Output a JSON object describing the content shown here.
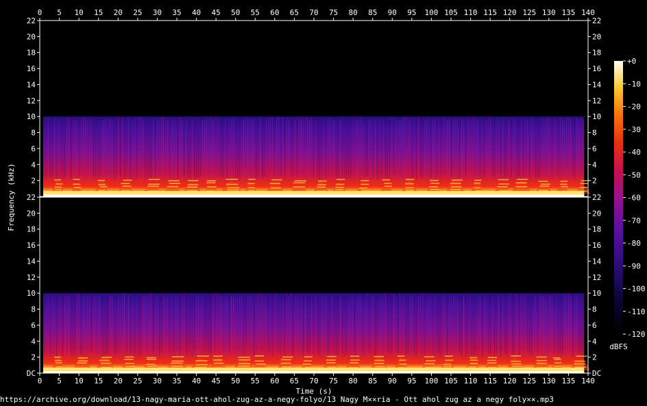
{
  "chart_data": {
    "type": "heatmap",
    "title": "",
    "xlabel": "Time (s)",
    "ylabel": "Frequency (kHz)",
    "x_ticks": [
      0,
      5,
      10,
      15,
      20,
      25,
      30,
      35,
      40,
      45,
      50,
      55,
      60,
      65,
      70,
      75,
      80,
      85,
      90,
      95,
      100,
      105,
      110,
      115,
      120,
      125,
      130,
      135,
      140
    ],
    "xlim": [
      0,
      140
    ],
    "audio_duration_s": 139,
    "channels": [
      {
        "name": "",
        "y_ticks": [
          "22",
          "20",
          "18",
          "16",
          "14",
          "12",
          "10",
          "8",
          "6",
          "4",
          "2"
        ],
        "ylim_khz": [
          0,
          22
        ]
      },
      {
        "name": "",
        "y_ticks": [
          "22",
          "20",
          "18",
          "16",
          "14",
          "12",
          "10",
          "8",
          "6",
          "4",
          "2",
          "DC"
        ],
        "ylim_khz": [
          0,
          22
        ]
      }
    ],
    "content_cutoff_khz": 10,
    "colorbar": {
      "label": "dBFS",
      "ticks": [
        "+0",
        "-10",
        "-20",
        "-30",
        "-40",
        "-50",
        "-60",
        "-70",
        "-80",
        "-90",
        "-100",
        "-110",
        "-120"
      ],
      "range_db": [
        -120,
        0
      ]
    }
  },
  "footer": {
    "source_path": "https://archive.org/download/13-nagy-maria-ott-ahol-zug-az-a-negy-folyo/13 Nagy M××ria - Ott ahol zug az a negy foly××.mp3"
  }
}
